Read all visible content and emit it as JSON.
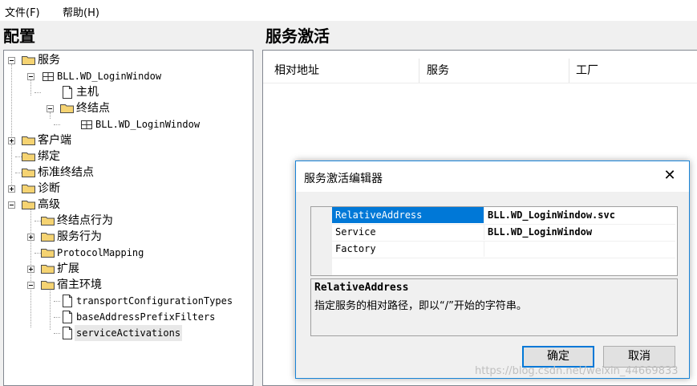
{
  "menu": {
    "file": "文件(F)",
    "help": "帮助(H)"
  },
  "left_panel": {
    "title": "配置"
  },
  "right_panel": {
    "title": "服务激活",
    "columns": [
      "相对地址",
      "服务",
      "工厂"
    ]
  },
  "tree": {
    "services": "服务",
    "service_entry": "BLL.WD_LoginWindow",
    "host": "主机",
    "endpoints": "终结点",
    "endpoint_entry": "BLL.WD_LoginWindow",
    "client": "客户端",
    "bindings": "绑定",
    "standard_endpoints": "标准终结点",
    "diagnostics": "诊断",
    "advanced": "高级",
    "endpoint_behaviors": "终结点行为",
    "service_behaviors": "服务行为",
    "protocol_mapping": "ProtocolMapping",
    "extensions": "扩展",
    "hosting_environment": "宿主环境",
    "transport_config_types": "transportConfigurationTypes",
    "base_address_prefix_filters": "baseAddressPrefixFilters",
    "service_activations": "serviceActivations"
  },
  "dialog": {
    "title": "服务激活编辑器",
    "close": "✕",
    "properties": [
      {
        "name": "RelativeAddress",
        "value": "BLL.WD_LoginWindow.svc"
      },
      {
        "name": "Service",
        "value": "BLL.WD_LoginWindow"
      },
      {
        "name": "Factory",
        "value": ""
      }
    ],
    "desc_title": "RelativeAddress",
    "desc_text": "指定服务的相对路径，即以“/”开始的字符串。",
    "ok": "确定",
    "cancel": "取消"
  },
  "watermark": "https://blog.csdn.net/weixin_44669833",
  "colors": {
    "selection": "#0078d7",
    "dialog_border": "#1883d7",
    "folder": "#f5d372"
  }
}
